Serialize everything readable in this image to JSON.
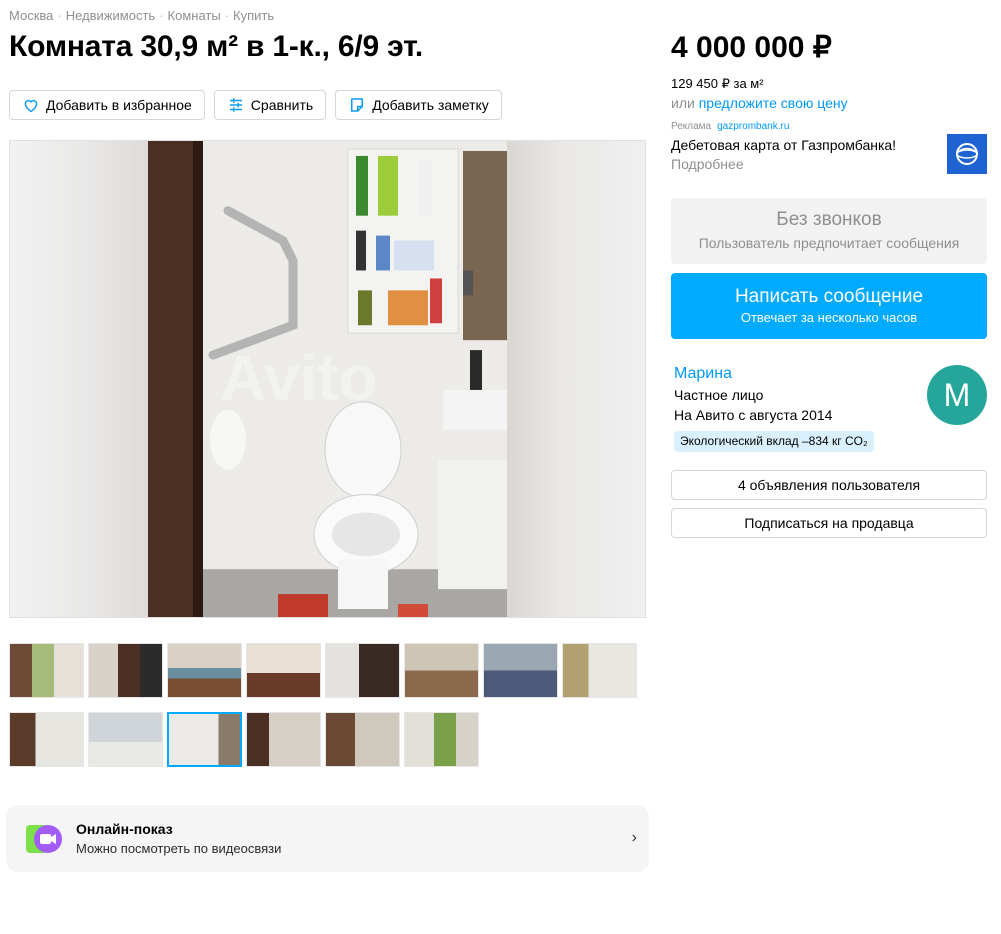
{
  "breadcrumbs": [
    "Москва",
    "Недвижимость",
    "Комнаты",
    "Купить"
  ],
  "title": "Комната 30,9 м² в 1-к., 6/9 эт.",
  "actions": {
    "favorite": "Добавить в избранное",
    "compare": "Сравнить",
    "note": "Добавить заметку"
  },
  "photo": {
    "watermark": "Avito",
    "thumbnail_count": 14,
    "active_thumbnail": 11
  },
  "online_show": {
    "title": "Онлайн-показ",
    "subtitle": "Можно посмотреть по видеосвязи"
  },
  "price": {
    "total": "4 000 000 ₽",
    "per_m2": "129 450 ₽ за м²",
    "offer_prefix": "или",
    "offer_link": "предложите свою цену"
  },
  "ad": {
    "label": "Реклама",
    "domain": "gazprombank.ru",
    "title": "Дебетовая карта от Газпромбанка!",
    "more": "Подробнее"
  },
  "contact": {
    "no_calls_title": "Без звонков",
    "no_calls_subtitle": "Пользователь предпочитает сообщения",
    "message_title": "Написать сообщение",
    "message_subtitle": "Отвечает за несколько часов"
  },
  "seller": {
    "name": "Марина",
    "type": "Частное лицо",
    "since": "На Авито с августа 2014",
    "eco": "Экологический вклад –834 кг CO₂",
    "avatar_letter": "М",
    "listings_button": "4 объявления пользователя",
    "subscribe_button": "Подписаться на продавца"
  },
  "colors": {
    "accent": "#00aaff",
    "link": "#0099f7",
    "avatar": "#26a69a",
    "eco_badge": "#d9f1ff"
  }
}
